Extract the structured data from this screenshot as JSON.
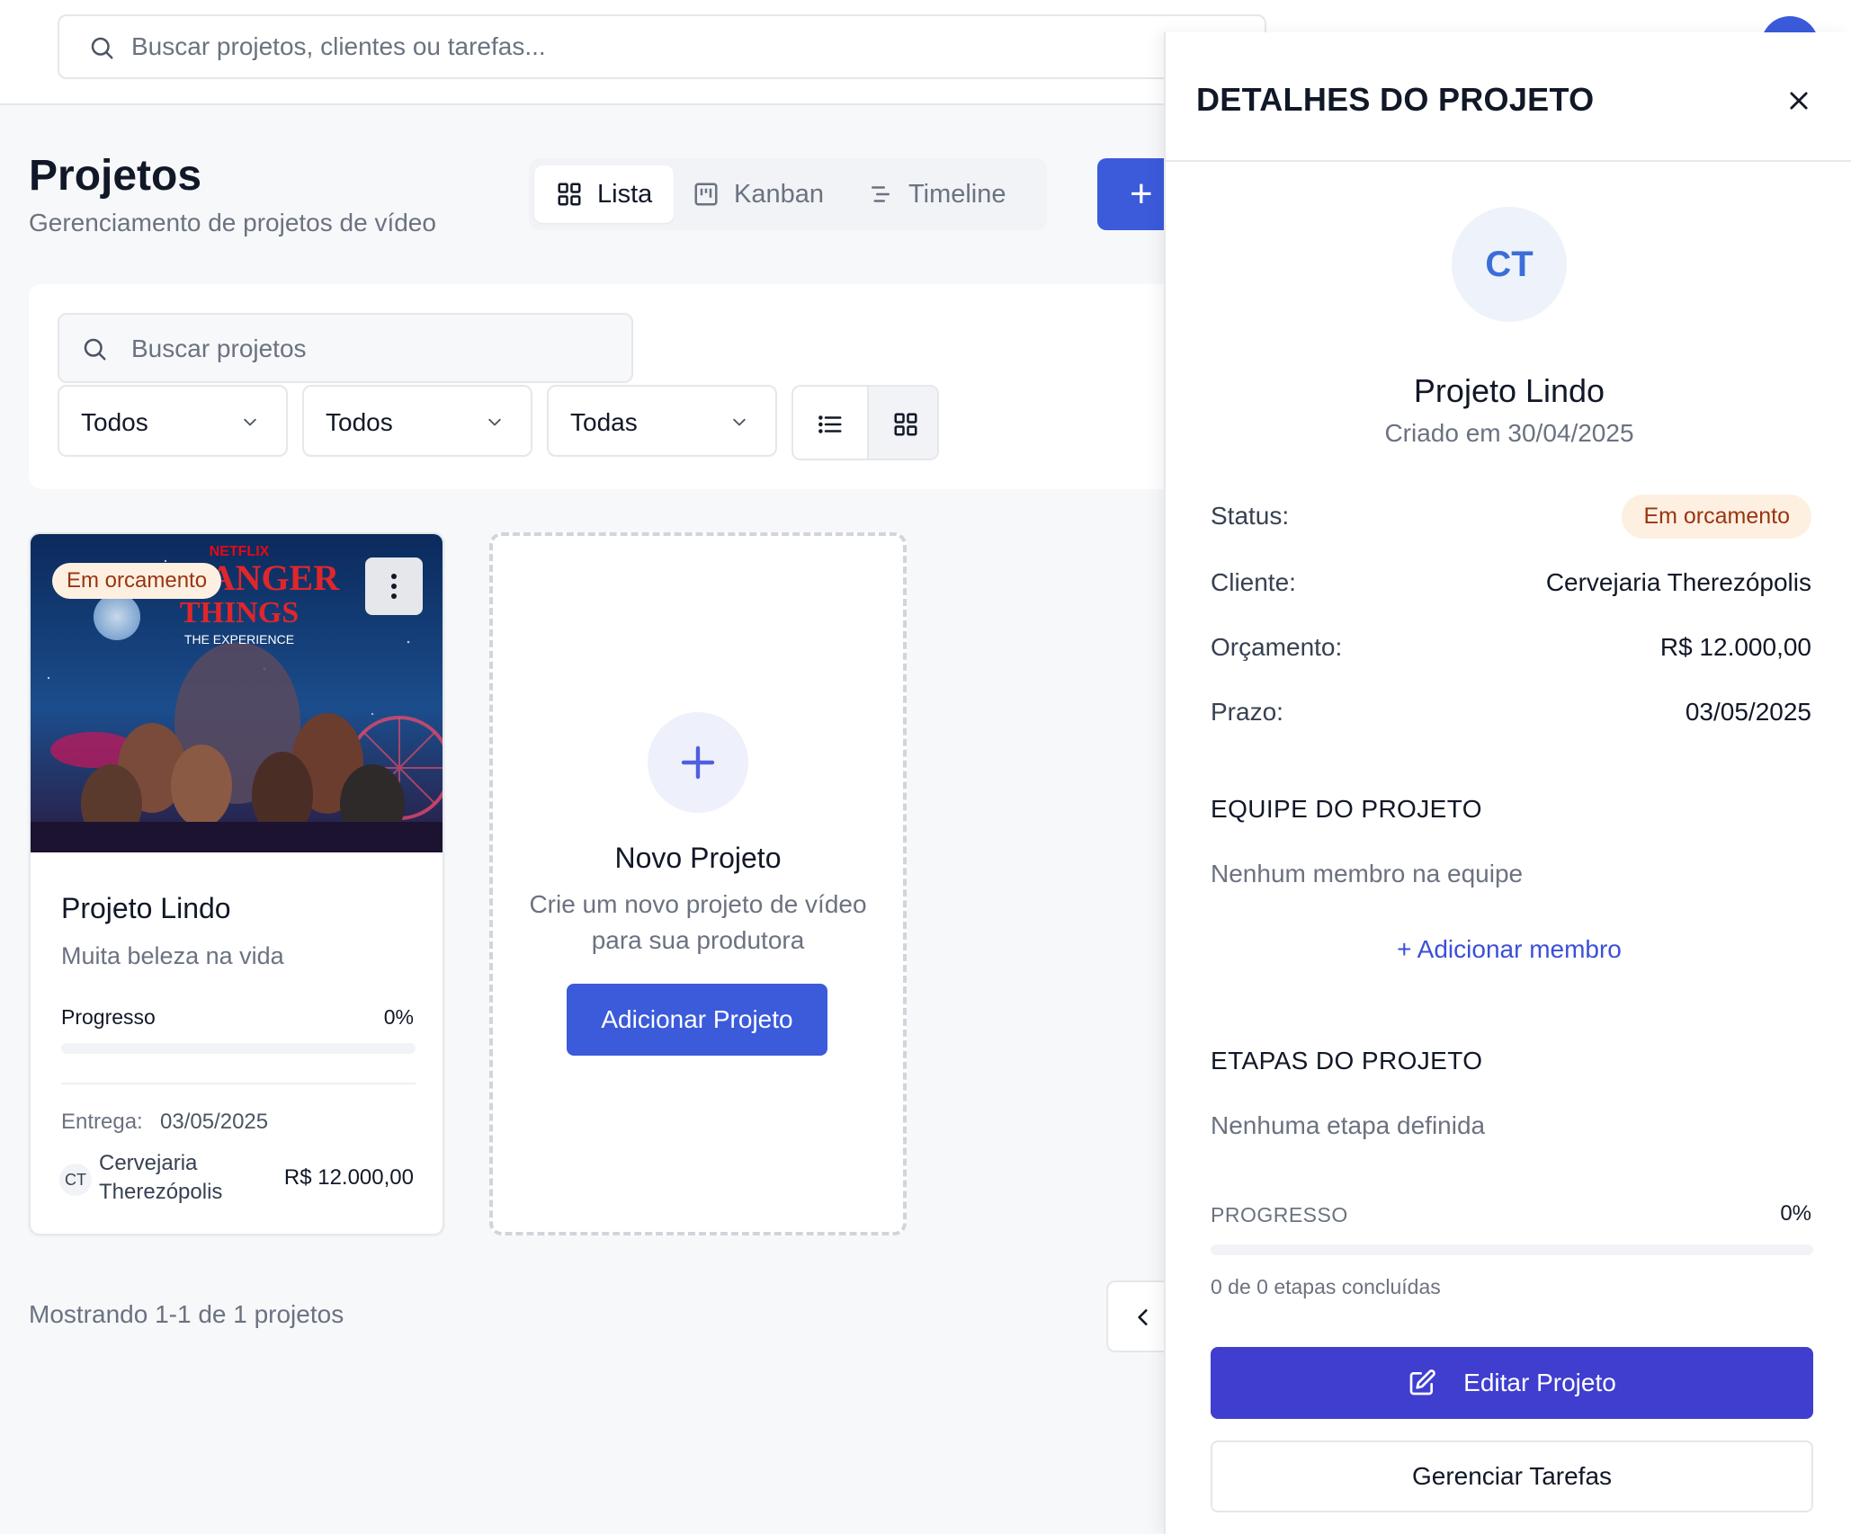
{
  "topbar": {
    "search_placeholder": "Buscar projetos, clientes ou tarefas..."
  },
  "header": {
    "title": "Projetos",
    "subtitle": "Gerenciamento de projetos de vídeo",
    "views": [
      {
        "label": "Lista",
        "icon": "grid-icon",
        "active": true
      },
      {
        "label": "Kanban",
        "icon": "kanban-icon",
        "active": false
      },
      {
        "label": "Timeline",
        "icon": "timeline-icon",
        "active": false
      }
    ],
    "add_label": "+"
  },
  "filters": {
    "search_placeholder": "Buscar projetos",
    "selects": [
      "Todos",
      "Todos",
      "Todas"
    ],
    "layout_active": "grid"
  },
  "project_card": {
    "badge": "Em orcamento",
    "cover_texts": {
      "brand": "NETFLIX",
      "title_line1": "STRANGER",
      "title_line2": "THINGS",
      "tagline": "THE EXPERIENCE"
    },
    "title": "Projeto Lindo",
    "description": "Muita beleza na vida",
    "progress_label": "Progresso",
    "progress_pct": "0%",
    "progress_value": 0,
    "delivery_label": "Entrega:",
    "delivery_date": "03/05/2025",
    "client_initials": "CT",
    "client_name": "Cervejaria Therezópolis",
    "budget": "R$ 12.000,00"
  },
  "new_project_card": {
    "title": "Novo Projeto",
    "description": "Crie um novo projeto de vídeo para sua produtora",
    "button": "Adicionar Projeto"
  },
  "pagination": {
    "showing": "Mostrando 1-1 de 1 projetos"
  },
  "side_panel": {
    "title": "DETALHES DO PROJETO",
    "initials": "CT",
    "project_name": "Projeto Lindo",
    "created": "Criado em 30/04/2025",
    "status_label": "Status:",
    "status_value": "Em orcamento",
    "client_label": "Cliente:",
    "client_value": "Cervejaria Therezópolis",
    "budget_label": "Orçamento:",
    "budget_value": "R$ 12.000,00",
    "deadline_label": "Prazo:",
    "deadline_value": "03/05/2025",
    "team_title": "EQUIPE DO PROJETO",
    "team_empty": "Nenhum membro na equipe",
    "add_member": "+ Adicionar membro",
    "steps_title": "ETAPAS DO PROJETO",
    "steps_empty": "Nenhuma etapa definida",
    "progress_title": "PROGRESSO",
    "progress_pct": "0%",
    "progress_value": 0,
    "steps_done": "0 de 0 etapas concluídas",
    "edit_button": "Editar Projeto",
    "tasks_button": "Gerenciar Tarefas"
  },
  "colors": {
    "accent": "#3b5bdb",
    "edit_button": "#3f3ecf",
    "badge_bg": "#fdf0e0",
    "badge_text": "#9a3412"
  }
}
